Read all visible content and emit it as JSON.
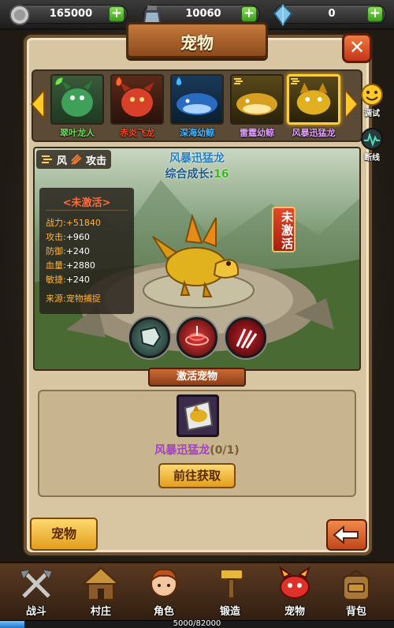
{
  "resources": {
    "gold": "165000",
    "crystal": "10060",
    "gem": "0"
  },
  "window": {
    "title": "宠物"
  },
  "pets": [
    {
      "name": "翠叶龙人",
      "color": "#6ee05a"
    },
    {
      "name": "赤炎飞龙",
      "color": "#ff4a2a"
    },
    {
      "name": "深海幼鲸",
      "color": "#4ab8ff"
    },
    {
      "name": "雷霆幼鲸",
      "color": "#e0a0ff"
    },
    {
      "name": "风暴迅猛龙",
      "color": "#e0a0ff"
    }
  ],
  "side": {
    "debug": "调试",
    "disconnect": "断线"
  },
  "detail": {
    "element": "风",
    "attack_type": "攻击",
    "name": "风暴迅猛龙",
    "growth_label": "综合成长:",
    "growth_value": "16",
    "state": "<未激活>",
    "badge": "未激活",
    "stats": [
      {
        "k": "战力:",
        "v": "+51840"
      },
      {
        "k": "攻击:",
        "v": "+960"
      },
      {
        "k": "防御:",
        "v": "+240"
      },
      {
        "k": "血量:",
        "v": "+2880"
      },
      {
        "k": "敏捷:",
        "v": "+240"
      }
    ],
    "source_label": "来源:",
    "source_value": "宠物捕捉"
  },
  "activate": {
    "header": "激活宠物",
    "fragment_name": "风暴迅猛龙",
    "fragment_count": "(0/1)",
    "go_button": "前往获取"
  },
  "footer": {
    "tab_label": "宠物"
  },
  "nav": [
    {
      "label": "战斗"
    },
    {
      "label": "村庄"
    },
    {
      "label": "角色"
    },
    {
      "label": "锻造"
    },
    {
      "label": "宠物"
    },
    {
      "label": "背包"
    }
  ],
  "xp": {
    "text": "5000/82000",
    "fraction": 0.061
  }
}
